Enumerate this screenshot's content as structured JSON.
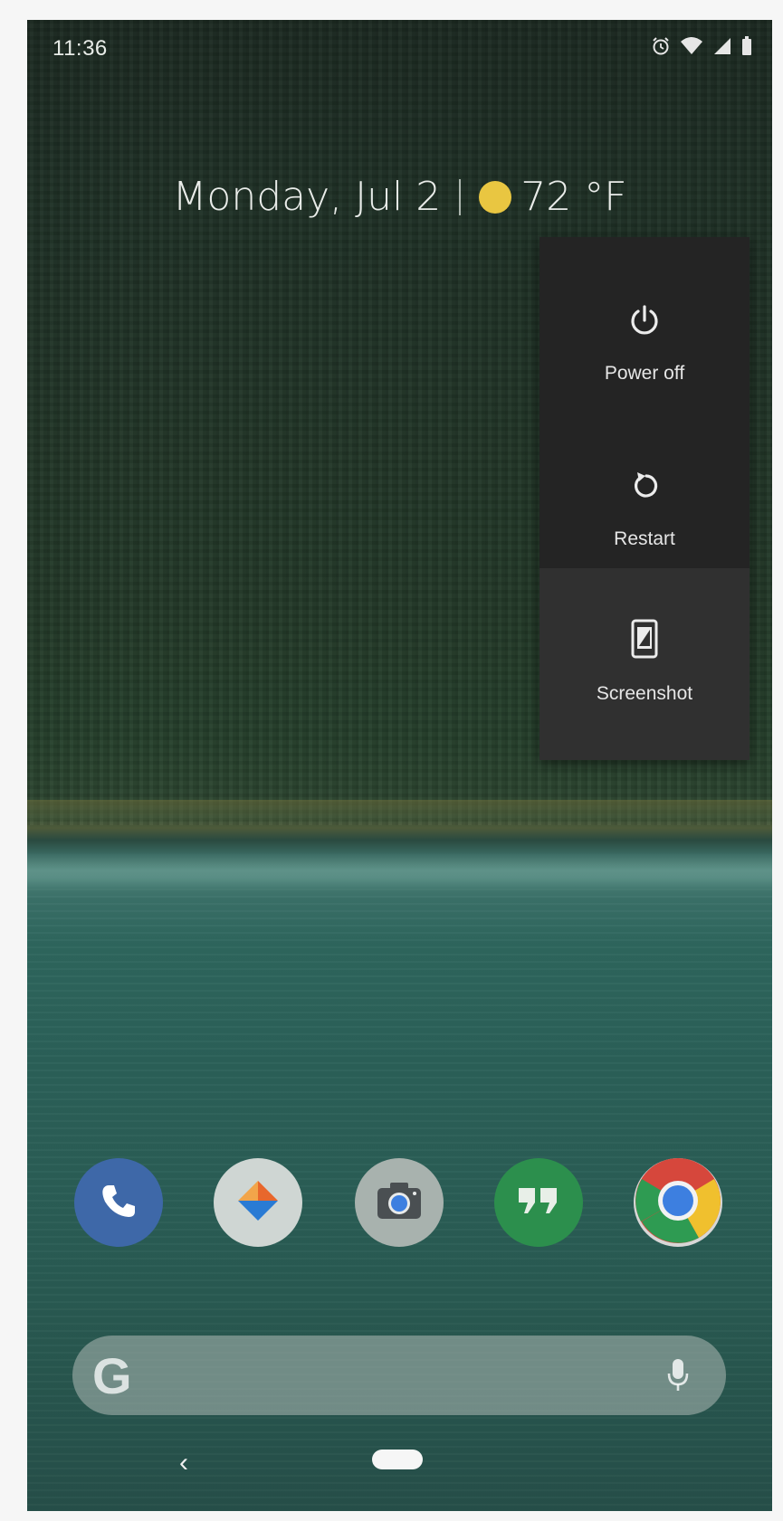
{
  "status_bar": {
    "time": "11:36",
    "icons": [
      "alarm-icon",
      "wifi-icon",
      "signal-icon",
      "battery-icon"
    ]
  },
  "glance": {
    "date": "Monday, Jul 2",
    "temperature": "72 °F",
    "weather_icon": "sun-icon",
    "weather_color": "#e9c641"
  },
  "power_menu": {
    "items": [
      {
        "label": "Power off",
        "icon": "power-icon"
      },
      {
        "label": "Restart",
        "icon": "restart-icon"
      },
      {
        "label": "Screenshot",
        "icon": "screenshot-icon"
      }
    ],
    "background": "#242424",
    "highlight": "#303030"
  },
  "dock": {
    "apps": [
      {
        "name": "Phone",
        "icon": "phone-icon",
        "color": "#3e68a8"
      },
      {
        "name": "Maps",
        "icon": "maps-icon",
        "color": "#cfd6d3"
      },
      {
        "name": "Camera",
        "icon": "camera-icon",
        "color": "#a8b2ae"
      },
      {
        "name": "Hangouts",
        "icon": "hangouts-icon",
        "color": "#2c8f4d"
      },
      {
        "name": "Chrome",
        "icon": "chrome-icon",
        "color": "#d7d7d7"
      }
    ]
  },
  "search": {
    "logo": "G",
    "mic_icon": "mic-icon"
  },
  "nav": {
    "back": "‹",
    "home_icon": "home-pill-icon"
  }
}
